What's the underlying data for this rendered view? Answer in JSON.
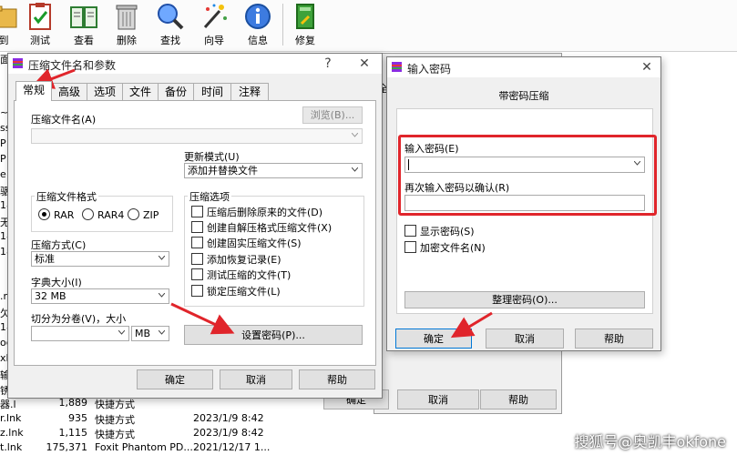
{
  "toolbar": {
    "items": [
      {
        "label": "到",
        "icon": "add-folder-icon"
      },
      {
        "label": "测试",
        "icon": "test-clipboard-icon"
      },
      {
        "label": "查看",
        "icon": "view-book-icon"
      },
      {
        "label": "删除",
        "icon": "trash-icon"
      },
      {
        "label": "查找",
        "icon": "search-icon"
      },
      {
        "label": "向导",
        "icon": "wizard-wand-icon"
      },
      {
        "label": "信息",
        "icon": "info-icon"
      },
      {
        "label": "修复",
        "icon": "repair-book-icon"
      }
    ]
  },
  "background_list": {
    "left_fragments": [
      "面",
      "~",
      "ss",
      "P",
      "P",
      "e",
      "骃",
      "18",
      "无",
      "18",
      "18",
      ".r",
      "欠",
      "18",
      "ocx",
      "xls",
      "输",
      "锈",
      "器.l",
      "r.lnk",
      "z.lnk",
      "t.lnk"
    ],
    "rows": [
      {
        "size": "1,889",
        "type": "快捷方式",
        "date": ""
      },
      {
        "size": "935",
        "type": "快捷方式",
        "date": "2023/1/9 8:42"
      },
      {
        "size": "1,115",
        "type": "快捷方式",
        "date": "2023/1/9 8:42"
      },
      {
        "size": "175,371",
        "type": "Foxit Phantom PD...",
        "date": "2021/12/17 1..."
      }
    ],
    "back_buttons": {
      "ok": "确定",
      "cancel": "取消",
      "help": "帮助"
    },
    "edge_char": "全"
  },
  "archive_dialog": {
    "title": "压缩文件名和参数",
    "help_glyph": "?",
    "close_glyph": "✕",
    "tabs": [
      "常规",
      "高级",
      "选项",
      "文件",
      "备份",
      "时间",
      "注释"
    ],
    "active_tab": "常规",
    "archive_name_label": "压缩文件名(A)",
    "browse_button": "浏览(B)...",
    "archive_name_value": "",
    "update_mode_label": "更新模式(U)",
    "update_mode_value": "添加并替换文件",
    "format_group_title": "压缩文件格式",
    "formats": [
      "RAR",
      "RAR4",
      "ZIP"
    ],
    "selected_format": "RAR",
    "method_label": "压缩方式(C)",
    "method_value": "标准",
    "dict_label": "字典大小(I)",
    "dict_value": "32 MB",
    "split_label": "切分为分卷(V)，大小",
    "split_value": "",
    "split_unit": "MB",
    "options_group_title": "压缩选项",
    "options": [
      "压缩后删除原来的文件(D)",
      "创建自解压格式压缩文件(X)",
      "创建固实压缩文件(S)",
      "添加恢复记录(E)",
      "测试压缩的文件(T)",
      "锁定压缩文件(L)"
    ],
    "set_password_button": "设置密码(P)...",
    "ok": "确定",
    "cancel": "取消",
    "help": "帮助"
  },
  "password_dialog": {
    "title": "输入密码",
    "close_glyph": "✕",
    "heading": "带密码压缩",
    "enter_label": "输入密码(E)",
    "enter_value": "",
    "confirm_label": "再次输入密码以确认(R)",
    "confirm_value": "",
    "show_password": "显示密码(S)",
    "encrypt_names": "加密文件名(N)",
    "organize_button": "整理密码(O)...",
    "ok": "确定",
    "cancel": "取消",
    "help": "帮助"
  },
  "watermark": "搜狐号@奥凯丰okfone",
  "colors": {
    "highlight": "#e0252b",
    "focus": "#0078d7"
  }
}
